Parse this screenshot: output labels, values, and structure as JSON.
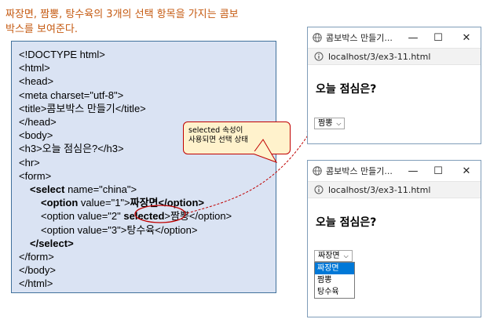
{
  "caption": {
    "line1": "짜장면, 짬뽕, 탕수육의 3개의 선택 항목을 가지는 콤보",
    "line2": "박스를 보여준다."
  },
  "code": {
    "l1": "<!DOCTYPE html>",
    "l2": "<html>",
    "l3": "<head>",
    "l4": "<meta charset=\"utf-8\">",
    "l5": "<title>콤보박스 만들기</title>",
    "l6": "</head>",
    "l7": "<body>",
    "l8": "<h3>오늘 점심은?</h3>",
    "l9": "<hr>",
    "l10": "<form>",
    "l11a": "<select",
    "l11b": " name=\"china\">",
    "l12a": "<option",
    "l12b": " value=\"1\">",
    "l12c": "짜장면</option>",
    "l13a": "<option value=\"2\" ",
    "l13b": "selected",
    "l13c": ">짬뽕</option>",
    "l14a": "<option value=\"3\">",
    "l14b": "탕수육</option>",
    "l15": "</select>",
    "l16": "</form>",
    "l17": "</body>",
    "l18": "</html>"
  },
  "callout": {
    "line1": "selected 속성이",
    "line2": "사용되면 선택 상태"
  },
  "browser_top": {
    "title": "콤보박스 만들기...",
    "url": "localhost/3/ex3-11.html",
    "heading": "오늘 점심은?",
    "select_value": "짬뽕"
  },
  "browser_bottom": {
    "title": "콤보박스 만들기...",
    "url": "localhost/3/ex3-11.html",
    "heading": "오늘 점심은?",
    "select_value": "짜장면",
    "options": [
      "짜장면",
      "짬뽕",
      "탕수육"
    ]
  },
  "window_controls": {
    "minimize": "—",
    "maximize": "☐",
    "close": "✕"
  },
  "colors": {
    "caption": "#c55a11",
    "panel_bg": "#dae3f3",
    "callout_bg": "#fff2cc",
    "accent_red": "#c00000",
    "highlight": "#0078d7"
  },
  "icons": [
    "globe-icon",
    "info-icon",
    "chevron-down-icon",
    "minimize-icon",
    "maximize-icon",
    "close-icon"
  ]
}
